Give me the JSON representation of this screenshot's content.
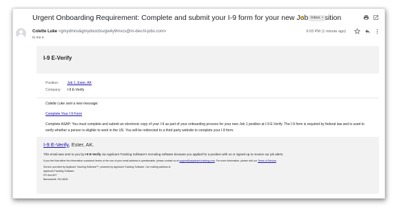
{
  "email": {
    "subject": "Urgent Onboarding Requirement: Complete and submit your I-9 form for your new Job 1 position",
    "label": "Inbox",
    "label_close": "×",
    "sender_name": "Colette Luke",
    "sender_email": "<gmydmns&gmydoocbsvgw4y9mvcs@m-dev.hl-jobs.com>",
    "to_line": "to me",
    "time": "6:03 PM (1 minute ago)"
  },
  "message_card": {
    "title": "I-9 E-Verify",
    "position_label": "Position:",
    "position_value": "Job 1, Ester, AK",
    "company_label": "Company:",
    "company_value": "I-9 E-Verify",
    "intro": "Colette Luke sent a new message:",
    "cta_link": "Complete Your I-9 Form",
    "body": "Complete ASAP: You must complete and submit an electronic copy of your I-9 as part of your onboarding process for your new Job 1 position at I-9 E-Verify. The I-9 form is required by federal law and is used to verify whether a person is eligible to work in the US. You will be redirected to a third party website to complete your I-9 form."
  },
  "footer": {
    "title_link": "I-9 E-Verify",
    "title_rest": ", Ester, AK.",
    "sent_pre": "This email was sent to you by ",
    "sent_company": "I-9 E-Verify",
    "sent_post": " via Applicant Tracking Software's recruiting software because you applied for a position with us or signed up to receive our job alerts.",
    "legal_pre": "If you feel that either the information contained herein or the use of your email address is questionable, please contact us at ",
    "legal_email": "support@applicant-tracking.com",
    "legal_mid": ". For more information, please visit our ",
    "legal_terms": "Terms of Service",
    "legal_end": ".",
    "address": [
      "Service provided by Applicant Tracking Software™, powered by Applicant Tracking Software. Our mailing address is:",
      "Applicant Tracking Software",
      "PO Box 897",
      "Bartonsville, PA 18031"
    ]
  },
  "icons": {
    "important": "label-important-icon",
    "print": "print-icon",
    "new_window": "open-in-new-window-icon",
    "star": "star-icon",
    "reply": "reply-icon",
    "more": "more-vertical-icon",
    "avatar": "avatar-icon"
  },
  "colors": {
    "link": "#1a0dab",
    "important": "#f2b400",
    "card_band": "#f2f2f2"
  }
}
